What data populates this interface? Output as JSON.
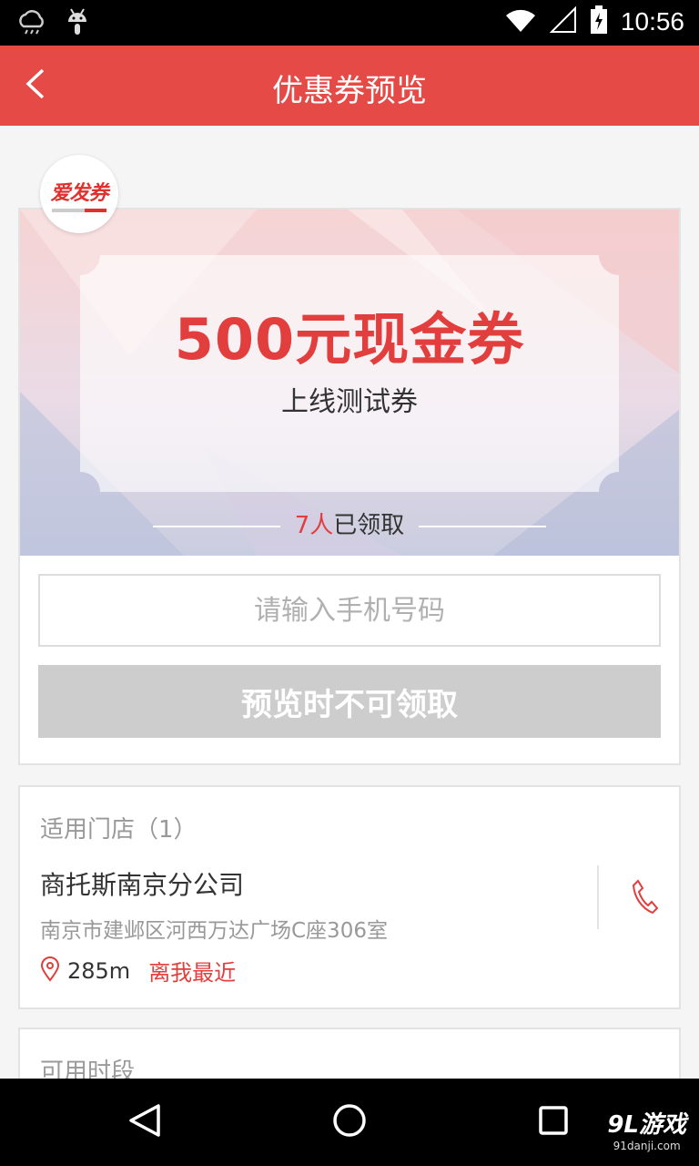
{
  "status_bar": {
    "time": "10:56"
  },
  "header": {
    "title": "优惠券预览"
  },
  "coupon": {
    "amount": "500元现金券",
    "name": "上线测试券",
    "claimed_count": "7人",
    "claimed_suffix": "已领取",
    "phone_placeholder": "请输入手机号码",
    "claim_button_label": "预览时不可领取",
    "logo_text": "爱发券"
  },
  "stores": {
    "section_title": "适用门店（1）",
    "items": [
      {
        "name": "商托斯南京分公司",
        "address": "南京市建邺区河西万达广场C座306室",
        "distance": "285m",
        "tag": "离我最近"
      }
    ]
  },
  "hours": {
    "section_title": "可用时段"
  },
  "watermark": {
    "main": "9L游戏",
    "sub": "91danji.com"
  },
  "colors": {
    "brand_red": "#e54a47",
    "accent_red": "#e23e3d",
    "disabled_gray": "#cdcdcd"
  }
}
